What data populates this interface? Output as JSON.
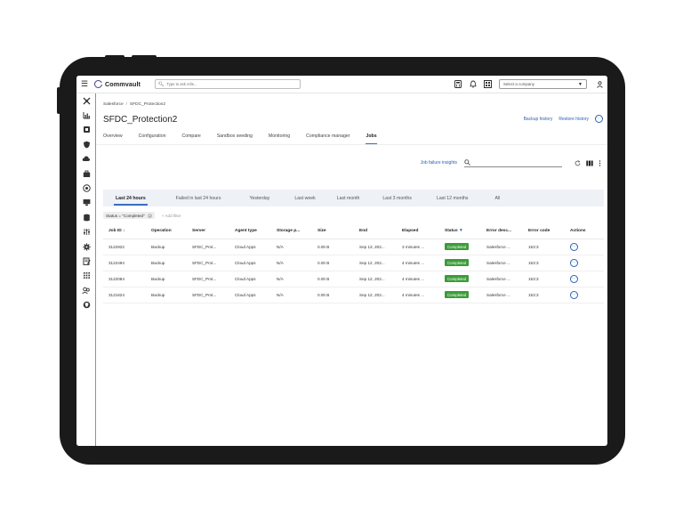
{
  "topbar": {
    "brand": "Commvault",
    "search_placeholder": "Type to ask Arlie...",
    "company_placeholder": "Select a company"
  },
  "sidebar": {
    "icons": [
      "tools-icon",
      "dashboard-chart-icon",
      "protect-shield-box-icon",
      "shield-icon",
      "cloud-backup-icon",
      "briefcase-icon",
      "globe-icon",
      "monitor-icon",
      "database-icon",
      "sliders-icon",
      "gear-icon",
      "report-icon",
      "apps-grid-icon",
      "users-icon",
      "globe-shield-icon"
    ]
  },
  "breadcrumb": {
    "root": "Salesforce",
    "separator": "/",
    "current": "SFDC_Protection2"
  },
  "page_title": "SFDC_Protection2",
  "header_links": {
    "backup_history": "Backup history",
    "restore_history": "Restore history"
  },
  "tabs": [
    "Overview",
    "Configuration",
    "Compare",
    "Sandbox seeding",
    "Monitoring",
    "Compliance manager",
    "Jobs"
  ],
  "active_tab": "Jobs",
  "jobs": {
    "insights_link": "Job failure insights",
    "time_tabs": [
      "Last 24 hours",
      "Failed in last 24 hours",
      "Yesterday",
      "Last week",
      "Last month",
      "Last 3 months",
      "Last 12 months",
      "All"
    ],
    "active_time_tab": "Last 24 hours",
    "filter_chip": "Status = \"Completed\"",
    "add_filter": "+ Add filter",
    "columns": [
      "Job ID ↓",
      "Operation",
      "Server",
      "Agent type",
      "Storage p...",
      "Size",
      "End",
      "Elapsed",
      "Status",
      "Error desc...",
      "Error code",
      "Actions"
    ],
    "rows": [
      {
        "job_id": "3122922",
        "operation": "Backup",
        "server": "SFDC_Prot...",
        "agent": "Cloud Apps",
        "storage": "N/A",
        "size": "0.00 B",
        "end": "Sep 13, 202...",
        "elapsed": "3 minutes ...",
        "status": "Completed",
        "error_desc": "Salesforce ...",
        "error_code": "153:3"
      },
      {
        "job_id": "3122494",
        "operation": "Backup",
        "server": "SFDC_Prot...",
        "agent": "Cloud Apps",
        "storage": "N/A",
        "size": "0.00 B",
        "end": "Sep 12, 202...",
        "elapsed": "4 minutes ...",
        "status": "Completed",
        "error_desc": "Salesforce ...",
        "error_code": "153:3"
      },
      {
        "job_id": "3122084",
        "operation": "Backup",
        "server": "SFDC_Prot...",
        "agent": "Cloud Apps",
        "storage": "N/A",
        "size": "0.00 B",
        "end": "Sep 12, 202...",
        "elapsed": "4 minutes ...",
        "status": "Completed",
        "error_desc": "Salesforce ...",
        "error_code": "153:3"
      },
      {
        "job_id": "3121624",
        "operation": "Backup",
        "server": "SFDC_Prot...",
        "agent": "Cloud Apps",
        "storage": "N/A",
        "size": "0.00 B",
        "end": "Sep 12, 202...",
        "elapsed": "4 minutes ...",
        "status": "Completed",
        "error_desc": "Salesforce ...",
        "error_code": "153:3"
      }
    ]
  },
  "colors": {
    "accent": "#2b5fb4",
    "completed": "#3e9b3a",
    "sidebar_border": "#9b7fd6",
    "frame": "#1a1a1a"
  }
}
